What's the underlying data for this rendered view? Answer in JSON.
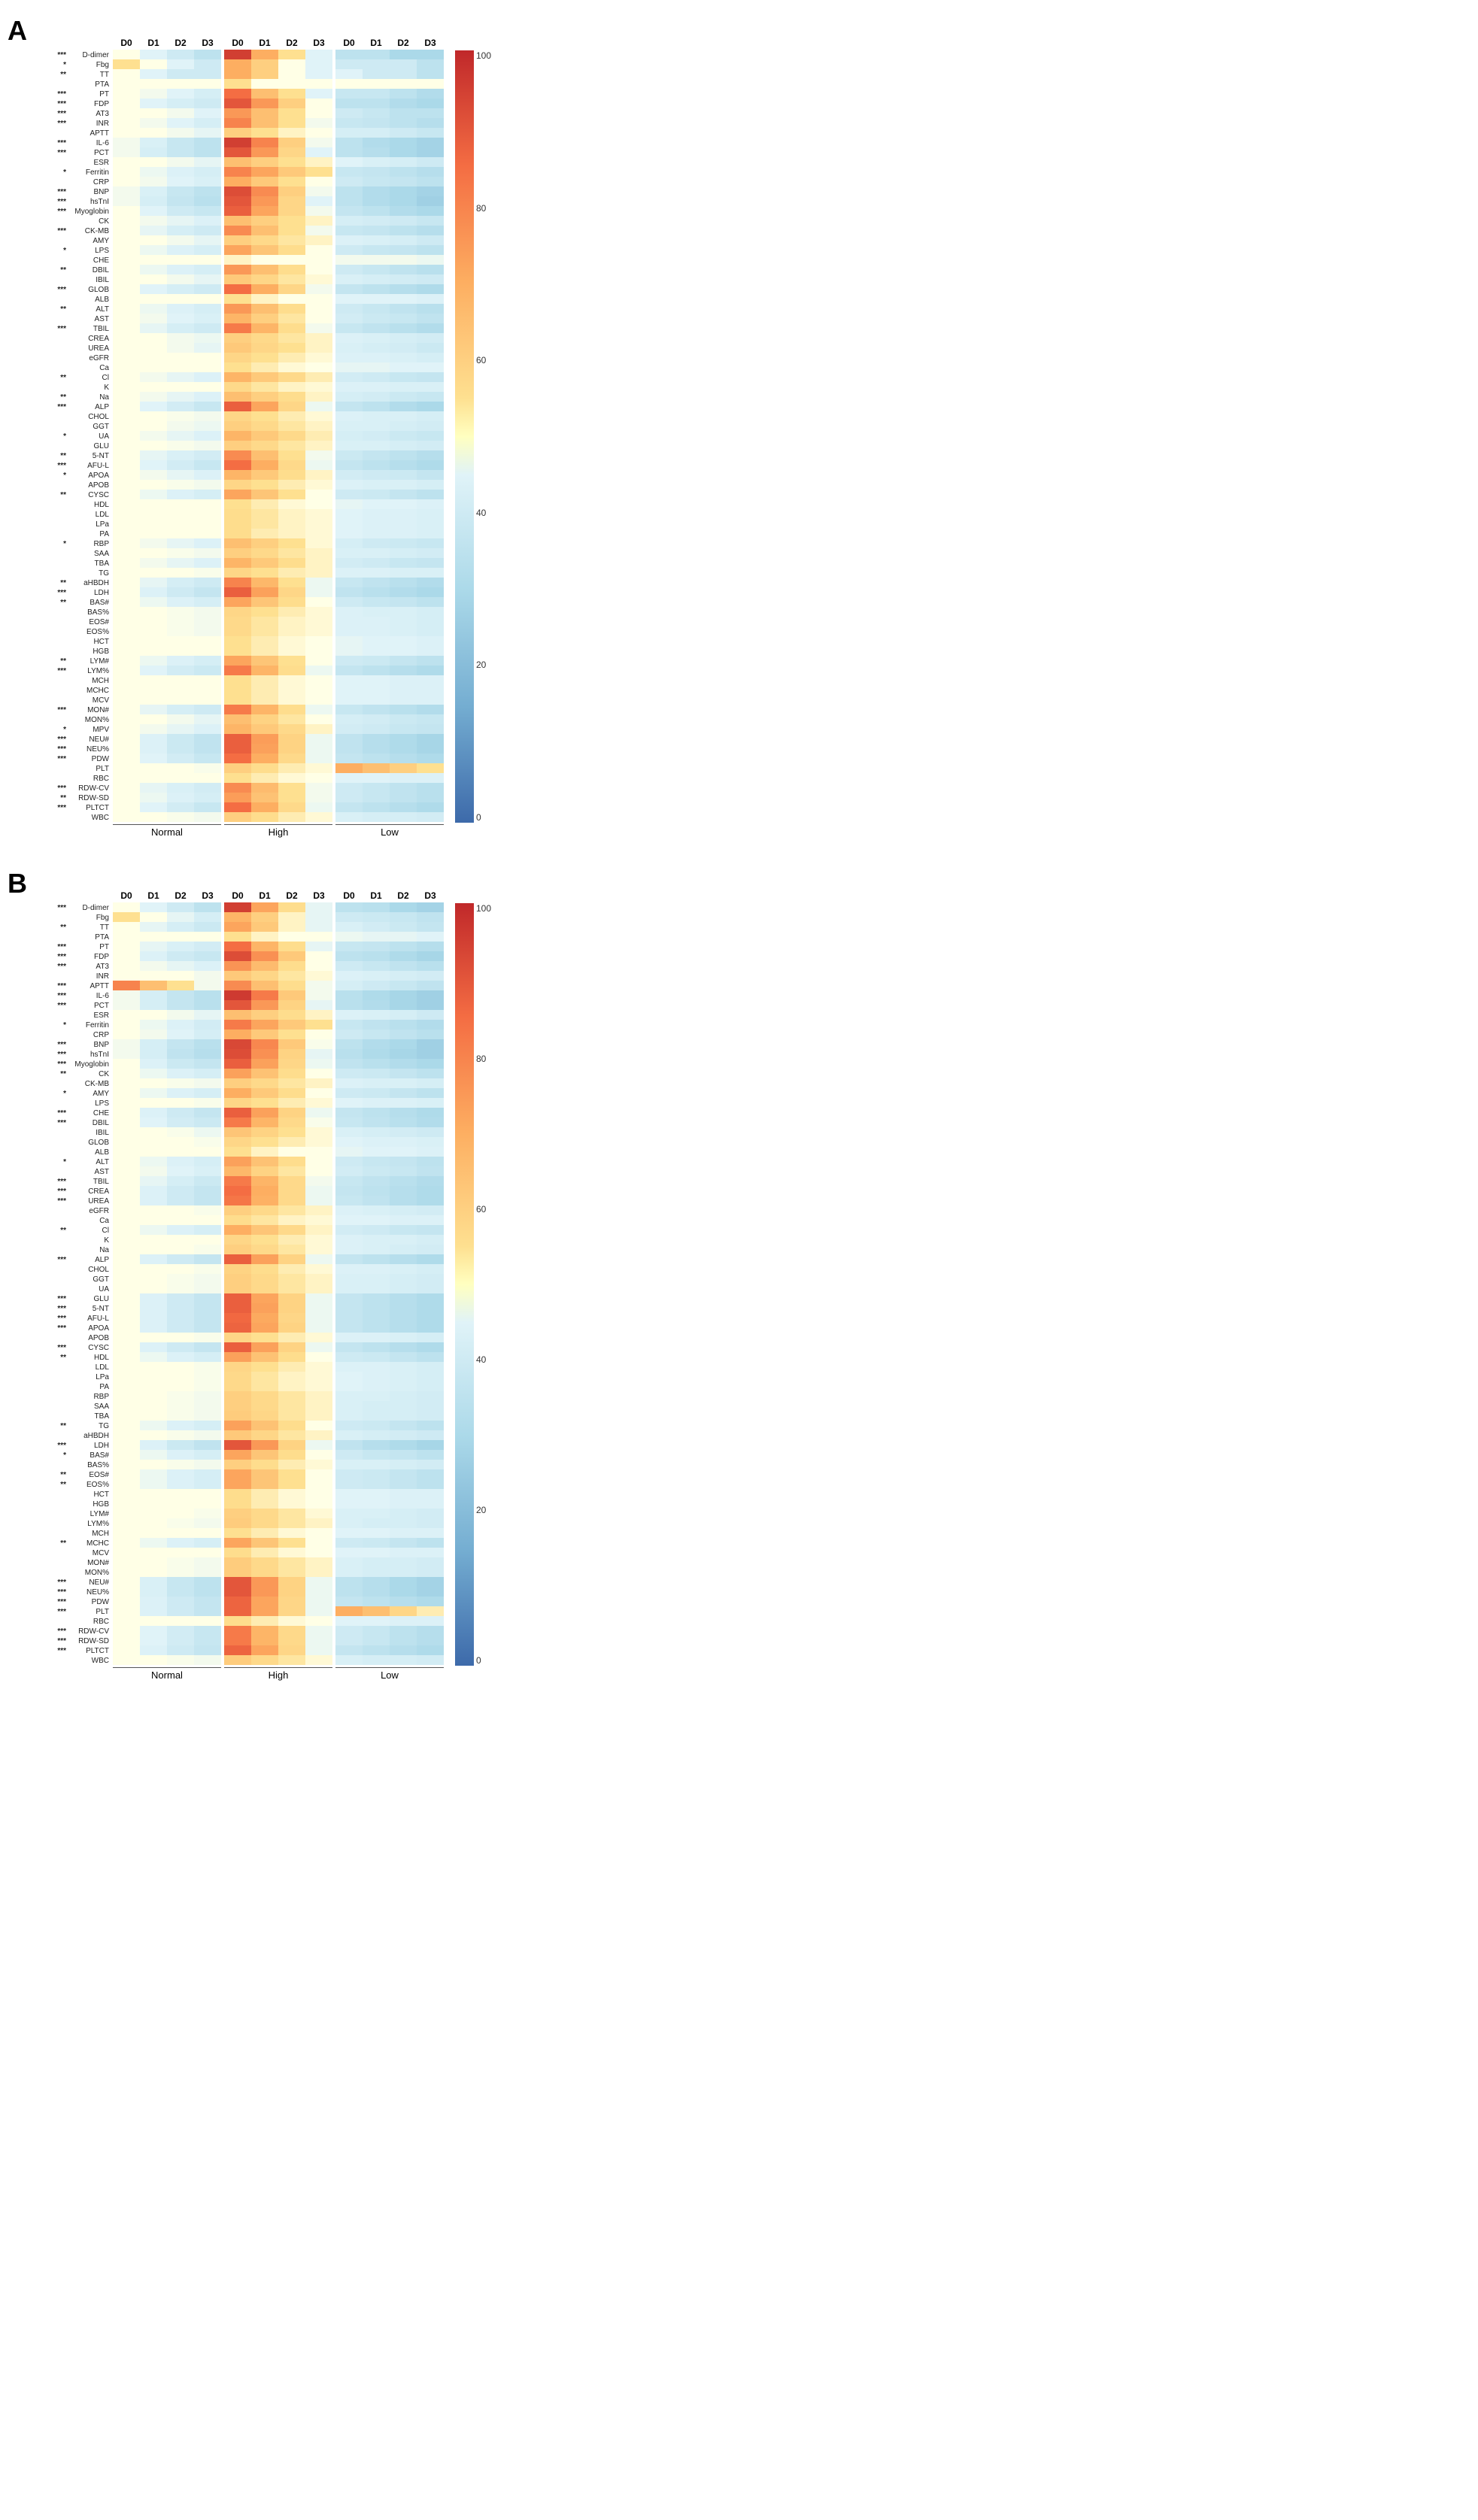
{
  "panels": [
    {
      "id": "A",
      "rows": [
        {
          "sig": "***",
          "gene": "D-dimer"
        },
        {
          "sig": "*",
          "gene": "Fbg"
        },
        {
          "sig": "**",
          "gene": "TT"
        },
        {
          "sig": "",
          "gene": "PTA"
        },
        {
          "sig": "***",
          "gene": "PT"
        },
        {
          "sig": "***",
          "gene": "FDP"
        },
        {
          "sig": "***",
          "gene": "AT3"
        },
        {
          "sig": "***",
          "gene": "INR"
        },
        {
          "sig": "",
          "gene": "APTT"
        },
        {
          "sig": "***",
          "gene": "IL-6"
        },
        {
          "sig": "***",
          "gene": "PCT"
        },
        {
          "sig": "",
          "gene": "ESR"
        },
        {
          "sig": "*",
          "gene": "Ferritin"
        },
        {
          "sig": "",
          "gene": "CRP"
        },
        {
          "sig": "***",
          "gene": "BNP"
        },
        {
          "sig": "***",
          "gene": "hsTnI"
        },
        {
          "sig": "***",
          "gene": "Myoglobin"
        },
        {
          "sig": "",
          "gene": "CK"
        },
        {
          "sig": "***",
          "gene": "CK-MB"
        },
        {
          "sig": "",
          "gene": "AMY"
        },
        {
          "sig": "*",
          "gene": "LPS"
        },
        {
          "sig": "",
          "gene": "CHE"
        },
        {
          "sig": "**",
          "gene": "DBIL"
        },
        {
          "sig": "",
          "gene": "IBIL"
        },
        {
          "sig": "***",
          "gene": "GLOB"
        },
        {
          "sig": "",
          "gene": "ALB"
        },
        {
          "sig": "**",
          "gene": "ALT"
        },
        {
          "sig": "",
          "gene": "AST"
        },
        {
          "sig": "***",
          "gene": "TBIL"
        },
        {
          "sig": "",
          "gene": "CREA"
        },
        {
          "sig": "",
          "gene": "UREA"
        },
        {
          "sig": "",
          "gene": "eGFR"
        },
        {
          "sig": "",
          "gene": "Ca"
        },
        {
          "sig": "**",
          "gene": "Cl"
        },
        {
          "sig": "",
          "gene": "K"
        },
        {
          "sig": "**",
          "gene": "Na"
        },
        {
          "sig": "***",
          "gene": "ALP"
        },
        {
          "sig": "",
          "gene": "CHOL"
        },
        {
          "sig": "",
          "gene": "GGT"
        },
        {
          "sig": "*",
          "gene": "UA"
        },
        {
          "sig": "",
          "gene": "GLU"
        },
        {
          "sig": "**",
          "gene": "5-NT"
        },
        {
          "sig": "***",
          "gene": "AFU-L"
        },
        {
          "sig": "*",
          "gene": "APOA"
        },
        {
          "sig": "",
          "gene": "APOB"
        },
        {
          "sig": "**",
          "gene": "CYSC"
        },
        {
          "sig": "",
          "gene": "HDL"
        },
        {
          "sig": "",
          "gene": "LDL"
        },
        {
          "sig": "",
          "gene": "LPa"
        },
        {
          "sig": "",
          "gene": "PA"
        },
        {
          "sig": "*",
          "gene": "RBP"
        },
        {
          "sig": "",
          "gene": "SAA"
        },
        {
          "sig": "",
          "gene": "TBA"
        },
        {
          "sig": "",
          "gene": "TG"
        },
        {
          "sig": "**",
          "gene": "aHBDH"
        },
        {
          "sig": "***",
          "gene": "LDH"
        },
        {
          "sig": "**",
          "gene": "BAS#"
        },
        {
          "sig": "",
          "gene": "BAS%"
        },
        {
          "sig": "",
          "gene": "EOS#"
        },
        {
          "sig": "",
          "gene": "EOS%"
        },
        {
          "sig": "",
          "gene": "HCT"
        },
        {
          "sig": "",
          "gene": "HGB"
        },
        {
          "sig": "**",
          "gene": "LYM#"
        },
        {
          "sig": "***",
          "gene": "LYM%"
        },
        {
          "sig": "",
          "gene": "MCH"
        },
        {
          "sig": "",
          "gene": "MCHC"
        },
        {
          "sig": "",
          "gene": "MCV"
        },
        {
          "sig": "***",
          "gene": "MON#"
        },
        {
          "sig": "",
          "gene": "MON%"
        },
        {
          "sig": "*",
          "gene": "MPV"
        },
        {
          "sig": "***",
          "gene": "NEU#"
        },
        {
          "sig": "***",
          "gene": "NEU%"
        },
        {
          "sig": "***",
          "gene": "PDW"
        },
        {
          "sig": "",
          "gene": "PLT"
        },
        {
          "sig": "",
          "gene": "RBC"
        },
        {
          "sig": "***",
          "gene": "RDW-CV"
        },
        {
          "sig": "**",
          "gene": "RDW-SD"
        },
        {
          "sig": "***",
          "gene": "PLTCT"
        },
        {
          "sig": "",
          "gene": "WBC"
        }
      ],
      "groups": [
        "Normal",
        "High",
        "Low"
      ],
      "timepoints": [
        "D0",
        "D1",
        "D2",
        "D3"
      ],
      "colorbar_labels": [
        "100",
        "80",
        "60",
        "40",
        "20",
        "0"
      ]
    },
    {
      "id": "B",
      "rows": [
        {
          "sig": "***",
          "gene": "D-dimer"
        },
        {
          "sig": "",
          "gene": "Fbg"
        },
        {
          "sig": "**",
          "gene": "TT"
        },
        {
          "sig": "",
          "gene": "PTA"
        },
        {
          "sig": "***",
          "gene": "PT"
        },
        {
          "sig": "***",
          "gene": "FDP"
        },
        {
          "sig": "***",
          "gene": "AT3"
        },
        {
          "sig": "",
          "gene": "INR"
        },
        {
          "sig": "***",
          "gene": "APTT"
        },
        {
          "sig": "***",
          "gene": "IL-6"
        },
        {
          "sig": "***",
          "gene": "PCT"
        },
        {
          "sig": "",
          "gene": "ESR"
        },
        {
          "sig": "*",
          "gene": "Ferritin"
        },
        {
          "sig": "",
          "gene": "CRP"
        },
        {
          "sig": "***",
          "gene": "BNP"
        },
        {
          "sig": "***",
          "gene": "hsTnI"
        },
        {
          "sig": "***",
          "gene": "Myoglobin"
        },
        {
          "sig": "**",
          "gene": "CK"
        },
        {
          "sig": "",
          "gene": "CK-MB"
        },
        {
          "sig": "*",
          "gene": "AMY"
        },
        {
          "sig": "",
          "gene": "LPS"
        },
        {
          "sig": "***",
          "gene": "CHE"
        },
        {
          "sig": "***",
          "gene": "DBIL"
        },
        {
          "sig": "",
          "gene": "IBIL"
        },
        {
          "sig": "",
          "gene": "GLOB"
        },
        {
          "sig": "",
          "gene": "ALB"
        },
        {
          "sig": "*",
          "gene": "ALT"
        },
        {
          "sig": "",
          "gene": "AST"
        },
        {
          "sig": "***",
          "gene": "TBIL"
        },
        {
          "sig": "***",
          "gene": "CREA"
        },
        {
          "sig": "***",
          "gene": "UREA"
        },
        {
          "sig": "",
          "gene": "eGFR"
        },
        {
          "sig": "",
          "gene": "Ca"
        },
        {
          "sig": "**",
          "gene": "Cl"
        },
        {
          "sig": "",
          "gene": "K"
        },
        {
          "sig": "",
          "gene": "Na"
        },
        {
          "sig": "***",
          "gene": "ALP"
        },
        {
          "sig": "",
          "gene": "CHOL"
        },
        {
          "sig": "",
          "gene": "GGT"
        },
        {
          "sig": "",
          "gene": "UA"
        },
        {
          "sig": "***",
          "gene": "GLU"
        },
        {
          "sig": "***",
          "gene": "5-NT"
        },
        {
          "sig": "***",
          "gene": "AFU-L"
        },
        {
          "sig": "***",
          "gene": "APOA"
        },
        {
          "sig": "",
          "gene": "APOB"
        },
        {
          "sig": "***",
          "gene": "CYSC"
        },
        {
          "sig": "**",
          "gene": "HDL"
        },
        {
          "sig": "",
          "gene": "LDL"
        },
        {
          "sig": "",
          "gene": "LPa"
        },
        {
          "sig": "",
          "gene": "PA"
        },
        {
          "sig": "",
          "gene": "RBP"
        },
        {
          "sig": "",
          "gene": "SAA"
        },
        {
          "sig": "",
          "gene": "TBA"
        },
        {
          "sig": "**",
          "gene": "TG"
        },
        {
          "sig": "",
          "gene": "aHBDH"
        },
        {
          "sig": "***",
          "gene": "LDH"
        },
        {
          "sig": "*",
          "gene": "BAS#"
        },
        {
          "sig": "",
          "gene": "BAS%"
        },
        {
          "sig": "**",
          "gene": "EOS#"
        },
        {
          "sig": "**",
          "gene": "EOS%"
        },
        {
          "sig": "",
          "gene": "HCT"
        },
        {
          "sig": "",
          "gene": "HGB"
        },
        {
          "sig": "",
          "gene": "LYM#"
        },
        {
          "sig": "",
          "gene": "LYM%"
        },
        {
          "sig": "",
          "gene": "MCH"
        },
        {
          "sig": "**",
          "gene": "MCHC"
        },
        {
          "sig": "",
          "gene": "MCV"
        },
        {
          "sig": "",
          "gene": "MON#"
        },
        {
          "sig": "",
          "gene": "MON%"
        },
        {
          "sig": "***",
          "gene": "NEU#"
        },
        {
          "sig": "***",
          "gene": "NEU%"
        },
        {
          "sig": "***",
          "gene": "PDW"
        },
        {
          "sig": "***",
          "gene": "PLT"
        },
        {
          "sig": "",
          "gene": "RBC"
        },
        {
          "sig": "***",
          "gene": "RDW-CV"
        },
        {
          "sig": "***",
          "gene": "RDW-SD"
        },
        {
          "sig": "***",
          "gene": "PLTCT"
        },
        {
          "sig": "",
          "gene": "WBC"
        }
      ],
      "groups": [
        "Normal",
        "High",
        "Low"
      ],
      "timepoints": [
        "D0",
        "D1",
        "D2",
        "D3"
      ],
      "colorbar_labels": [
        "100",
        "80",
        "60",
        "40",
        "20",
        "0"
      ]
    }
  ],
  "colors": {
    "high": "#d73027",
    "mid_high": "#f46d43",
    "mid": "#ffffbf",
    "mid_low": "#abd9e9",
    "low": "#4575b4"
  }
}
